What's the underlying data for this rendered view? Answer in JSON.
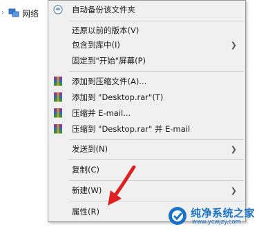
{
  "explorer": {
    "nav_label": "网络"
  },
  "menu": {
    "items": [
      {
        "label": "自动备份该文件夹",
        "icon": "cloud-backup-icon",
        "submenu": false
      },
      {
        "label": "还原以前的版本(V)",
        "icon": "",
        "submenu": false
      },
      {
        "label": "包含到库中(I)",
        "icon": "",
        "submenu": true
      },
      {
        "label": "固定到\"开始\"屏幕(P)",
        "icon": "",
        "submenu": false
      },
      {
        "label": "添加到压缩文件(A)...",
        "icon": "winrar-icon",
        "submenu": false
      },
      {
        "label": "添加到 \"Desktop.rar\"(T)",
        "icon": "winrar-icon",
        "submenu": false
      },
      {
        "label": "压缩并 E-mail...",
        "icon": "winrar-icon",
        "submenu": false
      },
      {
        "label": "压缩到 \"Desktop.rar\" 并 E-mail",
        "icon": "winrar-icon",
        "submenu": false
      },
      {
        "label": "发送到(N)",
        "icon": "",
        "submenu": true
      },
      {
        "label": "复制(C)",
        "icon": "",
        "submenu": false
      },
      {
        "label": "新建(W)",
        "icon": "",
        "submenu": true
      },
      {
        "label": "属性(R)",
        "icon": "",
        "submenu": false
      }
    ]
  },
  "watermark": {
    "name": "纯净系统之家",
    "url": "www.ycwjzy.com"
  },
  "colors": {
    "menu_bg": "#f0f0f0",
    "pointer": "#e02020",
    "watermark": "#1a73c9"
  }
}
